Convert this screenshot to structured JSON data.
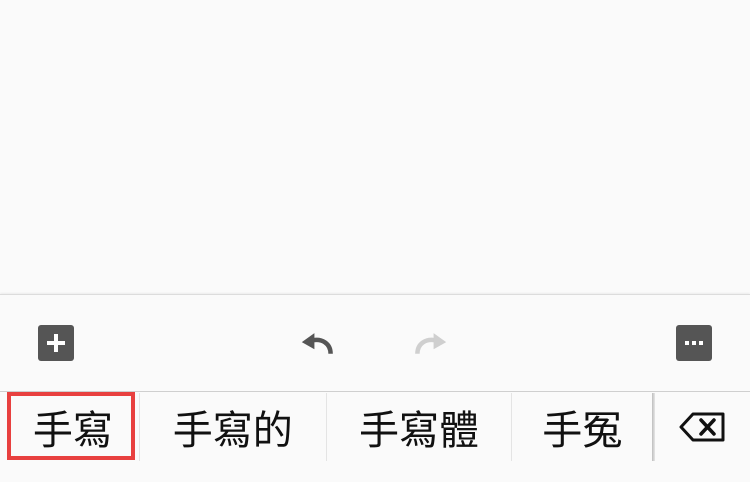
{
  "toolbar": {
    "add_icon": "plus-square-icon",
    "undo_icon": "undo-arrow-icon",
    "redo_icon": "redo-arrow-icon",
    "more_icon": "ellipsis-square-icon",
    "undo_enabled": true,
    "redo_enabled": false
  },
  "candidates": {
    "items": [
      {
        "text": "手寫",
        "selected": true
      },
      {
        "text": "手寫的",
        "selected": false
      },
      {
        "text": "手寫體",
        "selected": false
      },
      {
        "text": "手冤",
        "selected": false
      }
    ],
    "backspace_icon": "backspace-icon"
  },
  "colors": {
    "background": "#fafafa",
    "icon_dark": "#555555",
    "icon_disabled": "#cfcfcf",
    "highlight": "#e8403f",
    "text": "#111111"
  }
}
